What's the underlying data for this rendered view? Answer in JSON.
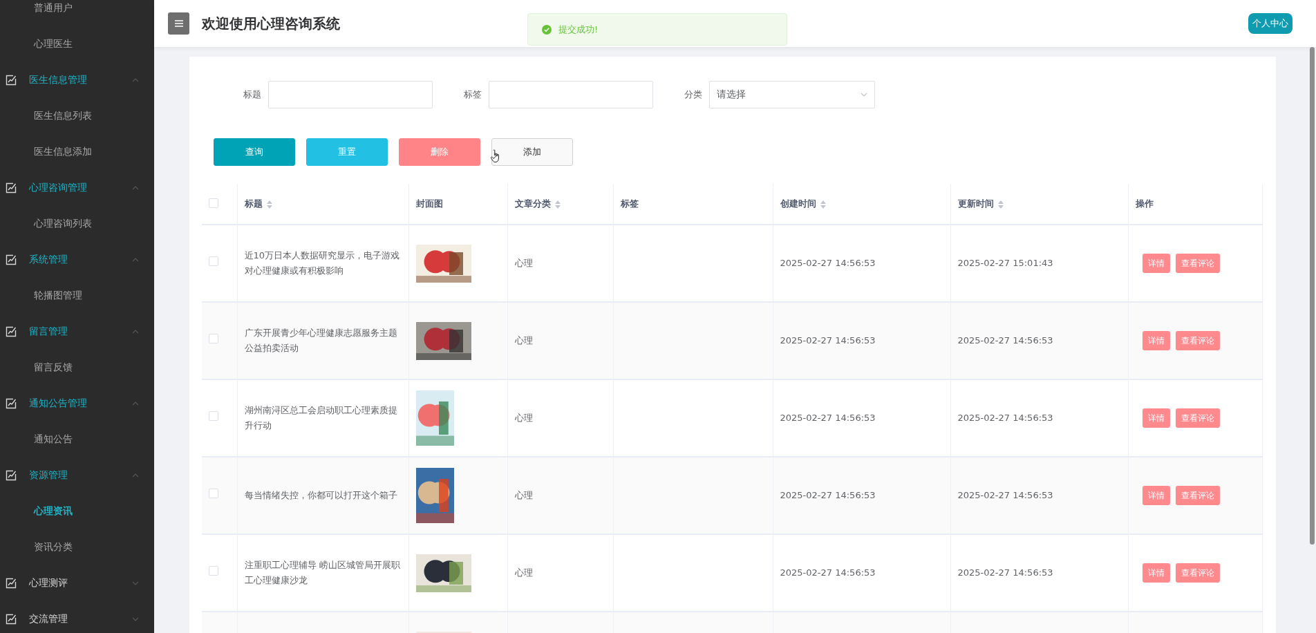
{
  "sidebar": {
    "items": [
      {
        "label": "普通用户",
        "kind": "sub",
        "selected": false
      },
      {
        "label": "心理医生",
        "kind": "sub",
        "selected": false
      },
      {
        "label": "医生信息管理",
        "kind": "group",
        "expanded": true
      },
      {
        "label": "医生信息列表",
        "kind": "sub",
        "selected": false
      },
      {
        "label": "医生信息添加",
        "kind": "sub",
        "selected": false
      },
      {
        "label": "心理咨询管理",
        "kind": "group",
        "expanded": true
      },
      {
        "label": "心理咨询列表",
        "kind": "sub",
        "selected": false
      },
      {
        "label": "系统管理",
        "kind": "group",
        "expanded": true
      },
      {
        "label": "轮播图管理",
        "kind": "sub",
        "selected": false
      },
      {
        "label": "留言管理",
        "kind": "group",
        "expanded": true
      },
      {
        "label": "留言反馈",
        "kind": "sub",
        "selected": false
      },
      {
        "label": "通知公告管理",
        "kind": "group",
        "expanded": true
      },
      {
        "label": "通知公告",
        "kind": "sub",
        "selected": false
      },
      {
        "label": "资源管理",
        "kind": "group",
        "expanded": true
      },
      {
        "label": "心理资讯",
        "kind": "sub",
        "selected": true
      },
      {
        "label": "资讯分类",
        "kind": "sub",
        "selected": false
      },
      {
        "label": "心理测评",
        "kind": "group",
        "expanded": false
      },
      {
        "label": "交流管理",
        "kind": "group",
        "expanded": false
      }
    ]
  },
  "header": {
    "title": "欢迎使用心理咨询系统",
    "user_button": "个人中心"
  },
  "toast": {
    "message": "提交成功!"
  },
  "filters": [
    {
      "label": "标题",
      "kind": "input"
    },
    {
      "label": "标签",
      "kind": "input"
    },
    {
      "label": "分类",
      "kind": "select",
      "placeholder": "请选择"
    }
  ],
  "buttons": [
    {
      "label": "查询",
      "kind": "primary"
    },
    {
      "label": "重置",
      "kind": "info"
    },
    {
      "label": "删除",
      "kind": "danger"
    },
    {
      "label": "添加",
      "kind": "default"
    }
  ],
  "table": {
    "header_checked": false,
    "columns": [
      {
        "label": "标题",
        "sortable": true
      },
      {
        "label": "封面图",
        "sortable": false
      },
      {
        "label": "文章分类",
        "sortable": true
      },
      {
        "label": "标签",
        "sortable": false
      },
      {
        "label": "创建时间",
        "sortable": true
      },
      {
        "label": "更新时间",
        "sortable": true
      },
      {
        "label": "操作",
        "sortable": false
      }
    ],
    "rows": [
      {
        "checked": false,
        "title": "近10万日本人数据研究显示，电子游戏对心理健康或有积极影响",
        "cover": {
          "kind": "picture"
        },
        "category": "心理",
        "created": "2025-02-27 14:56:53",
        "updated": "2025-02-27 15:01:43",
        "actions": [
          "详情",
          "查看评论"
        ]
      },
      {
        "checked": false,
        "title": "广东开展青少年心理健康志愿服务主题公益拍卖活动",
        "cover": {
          "kind": "picture"
        },
        "category": "心理",
        "created": "2025-02-27 14:56:53",
        "updated": "2025-02-27 14:56:53",
        "actions": [
          "详情",
          "查看评论"
        ]
      },
      {
        "checked": false,
        "title": "湖州南浔区总工会启动职工心理素质提升行动",
        "cover": {
          "kind": "picture"
        },
        "category": "心理",
        "created": "2025-02-27 14:56:53",
        "updated": "2025-02-27 14:56:53",
        "actions": [
          "详情",
          "查看评论"
        ]
      },
      {
        "checked": false,
        "title": "每当情绪失控，你都可以打开这个箱子",
        "cover": {
          "kind": "picture"
        },
        "category": "心理",
        "created": "2025-02-27 14:56:53",
        "updated": "2025-02-27 14:56:53",
        "actions": [
          "详情",
          "查看评论"
        ]
      },
      {
        "checked": false,
        "title": "注重职工心理辅导 崂山区城管局开展职工心理健康沙龙",
        "cover": {
          "kind": "picture"
        },
        "category": "心理",
        "created": "2025-02-27 14:56:53",
        "updated": "2025-02-27 14:56:53",
        "actions": [
          "详情",
          "查看评论"
        ]
      },
      {
        "cover": {
          "kind": "picture"
        }
      }
    ]
  }
}
